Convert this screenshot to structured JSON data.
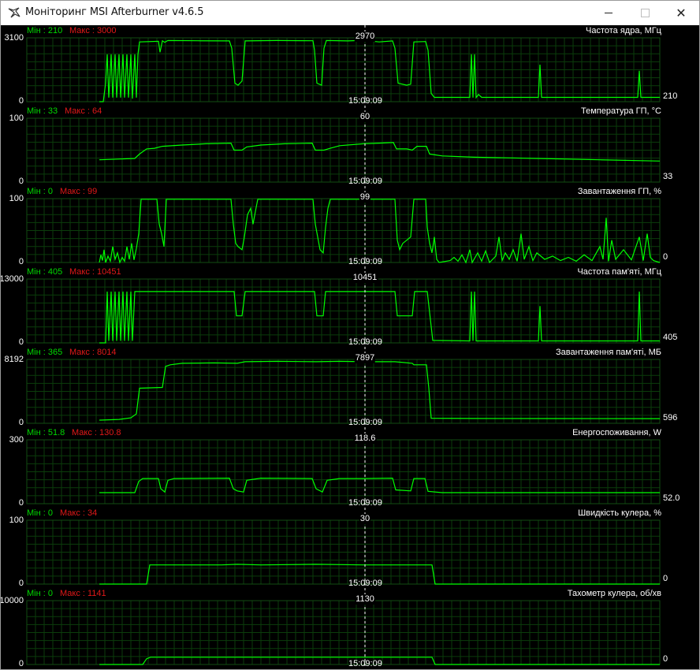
{
  "window": {
    "title": "Моніторинг MSI Afterburner v4.6.5",
    "controls": {
      "minimize": "minimize",
      "maximize": "maximize",
      "close": "close"
    }
  },
  "colors": {
    "background": "#000000",
    "grid": "#0b3d0b",
    "graph_line": "#00ff00",
    "cursor_line": "#ffffff",
    "min_text": "#00d800",
    "max_text": "#e01818"
  },
  "cursor_time": "15:09:09",
  "graphs": [
    {
      "name": "Частота ядра, МГц",
      "min_label": "Мін : 210",
      "max_label": "Макс : 3000",
      "y_top": "3100",
      "y_bottom": "0",
      "current": "210",
      "cursor_value": "2970",
      "ymax": 3100,
      "series": [
        [
          125,
          0
        ],
        [
          130,
          0
        ],
        [
          133,
          900
        ],
        [
          135,
          2300
        ],
        [
          137,
          200
        ],
        [
          140,
          2300
        ],
        [
          142,
          200
        ],
        [
          145,
          2300
        ],
        [
          147,
          200
        ],
        [
          150,
          2300
        ],
        [
          152,
          200
        ],
        [
          155,
          2300
        ],
        [
          157,
          200
        ],
        [
          160,
          2300
        ],
        [
          162,
          200
        ],
        [
          165,
          2300
        ],
        [
          167,
          150
        ],
        [
          170,
          2300
        ],
        [
          172,
          200
        ],
        [
          174,
          2300
        ],
        [
          176,
          2900
        ],
        [
          200,
          2930
        ],
        [
          202,
          2400
        ],
        [
          205,
          2960
        ],
        [
          208,
          2880
        ],
        [
          212,
          2970
        ],
        [
          250,
          2960
        ],
        [
          290,
          2950
        ],
        [
          293,
          2600
        ],
        [
          297,
          900
        ],
        [
          301,
          800
        ],
        [
          306,
          1000
        ],
        [
          310,
          2950
        ],
        [
          350,
          2970
        ],
        [
          396,
          2960
        ],
        [
          398,
          2500
        ],
        [
          401,
          900
        ],
        [
          407,
          800
        ],
        [
          410,
          2600
        ],
        [
          413,
          2970
        ],
        [
          440,
          2950
        ],
        [
          460,
          2980
        ],
        [
          480,
          2900
        ],
        [
          497,
          2950
        ],
        [
          500,
          2600
        ],
        [
          504,
          900
        ],
        [
          515,
          800
        ],
        [
          520,
          850
        ],
        [
          524,
          2900
        ],
        [
          539,
          2920
        ],
        [
          542,
          2500
        ],
        [
          546,
          400
        ],
        [
          550,
          210
        ],
        [
          595,
          210
        ],
        [
          597,
          2300
        ],
        [
          599,
          200
        ],
        [
          601,
          2300
        ],
        [
          603,
          200
        ],
        [
          606,
          350
        ],
        [
          610,
          210
        ],
        [
          682,
          210
        ],
        [
          684,
          1800
        ],
        [
          686,
          210
        ],
        [
          808,
          210
        ],
        [
          810,
          1500
        ],
        [
          812,
          210
        ],
        [
          836,
          210
        ]
      ]
    },
    {
      "name": "Температура ГП, °C",
      "min_label": "Мін : 33",
      "max_label": "Макс : 64",
      "y_top": "100",
      "y_bottom": "0",
      "current": "33",
      "cursor_value": "60",
      "ymax": 100,
      "series": [
        [
          125,
          35
        ],
        [
          150,
          36
        ],
        [
          170,
          37
        ],
        [
          176,
          44
        ],
        [
          185,
          52
        ],
        [
          195,
          53
        ],
        [
          205,
          56
        ],
        [
          230,
          58
        ],
        [
          260,
          60
        ],
        [
          292,
          61
        ],
        [
          296,
          50
        ],
        [
          306,
          50
        ],
        [
          312,
          55
        ],
        [
          330,
          58
        ],
        [
          360,
          60
        ],
        [
          395,
          61
        ],
        [
          399,
          50
        ],
        [
          410,
          50
        ],
        [
          418,
          53
        ],
        [
          430,
          57
        ],
        [
          460,
          60
        ],
        [
          480,
          61
        ],
        [
          498,
          62
        ],
        [
          502,
          52
        ],
        [
          515,
          52
        ],
        [
          522,
          50
        ],
        [
          528,
          56
        ],
        [
          540,
          56
        ],
        [
          544,
          44
        ],
        [
          560,
          41
        ],
        [
          600,
          39
        ],
        [
          680,
          37
        ],
        [
          760,
          35
        ],
        [
          836,
          33
        ]
      ]
    },
    {
      "name": "Завантаження ГП, %",
      "min_label": "Мін : 0",
      "max_label": "Макс : 99",
      "y_top": "100",
      "y_bottom": "0",
      "current": "0",
      "cursor_value": "99",
      "ymax": 100,
      "series": [
        [
          125,
          0
        ],
        [
          127,
          12
        ],
        [
          129,
          3
        ],
        [
          131,
          20
        ],
        [
          133,
          0
        ],
        [
          136,
          10
        ],
        [
          139,
          2
        ],
        [
          142,
          25
        ],
        [
          145,
          5
        ],
        [
          148,
          15
        ],
        [
          151,
          0
        ],
        [
          154,
          8
        ],
        [
          157,
          2
        ],
        [
          160,
          25
        ],
        [
          163,
          5
        ],
        [
          166,
          30
        ],
        [
          169,
          4
        ],
        [
          172,
          22
        ],
        [
          175,
          45
        ],
        [
          178,
          99
        ],
        [
          198,
          99
        ],
        [
          201,
          60
        ],
        [
          204,
          45
        ],
        [
          207,
          25
        ],
        [
          210,
          99
        ],
        [
          292,
          99
        ],
        [
          295,
          60
        ],
        [
          298,
          30
        ],
        [
          301,
          25
        ],
        [
          306,
          20
        ],
        [
          309,
          40
        ],
        [
          313,
          75
        ],
        [
          317,
          85
        ],
        [
          320,
          60
        ],
        [
          323,
          80
        ],
        [
          326,
          99
        ],
        [
          396,
          99
        ],
        [
          399,
          60
        ],
        [
          402,
          40
        ],
        [
          405,
          20
        ],
        [
          409,
          15
        ],
        [
          412,
          55
        ],
        [
          415,
          85
        ],
        [
          418,
          99
        ],
        [
          500,
          99
        ],
        [
          503,
          35
        ],
        [
          506,
          20
        ],
        [
          510,
          30
        ],
        [
          515,
          35
        ],
        [
          520,
          40
        ],
        [
          524,
          99
        ],
        [
          539,
          99
        ],
        [
          541,
          55
        ],
        [
          544,
          30
        ],
        [
          547,
          15
        ],
        [
          550,
          40
        ],
        [
          553,
          5
        ],
        [
          556,
          0
        ],
        [
          570,
          3
        ],
        [
          575,
          8
        ],
        [
          580,
          2
        ],
        [
          585,
          12
        ],
        [
          590,
          0
        ],
        [
          595,
          20
        ],
        [
          598,
          0
        ],
        [
          605,
          15
        ],
        [
          610,
          2
        ],
        [
          615,
          18
        ],
        [
          620,
          0
        ],
        [
          628,
          10
        ],
        [
          632,
          40
        ],
        [
          636,
          3
        ],
        [
          640,
          15
        ],
        [
          645,
          5
        ],
        [
          650,
          20
        ],
        [
          655,
          2
        ],
        [
          660,
          45
        ],
        [
          664,
          5
        ],
        [
          670,
          25
        ],
        [
          675,
          3
        ],
        [
          680,
          15
        ],
        [
          690,
          5
        ],
        [
          700,
          10
        ],
        [
          710,
          3
        ],
        [
          720,
          8
        ],
        [
          730,
          2
        ],
        [
          740,
          12
        ],
        [
          750,
          3
        ],
        [
          760,
          25
        ],
        [
          764,
          5
        ],
        [
          768,
          70
        ],
        [
          771,
          2
        ],
        [
          775,
          35
        ],
        [
          780,
          5
        ],
        [
          790,
          20
        ],
        [
          800,
          4
        ],
        [
          810,
          40
        ],
        [
          815,
          3
        ],
        [
          820,
          45
        ],
        [
          824,
          8
        ],
        [
          828,
          3
        ],
        [
          836,
          0
        ]
      ]
    },
    {
      "name": "Частота пам'яті, МГц",
      "min_label": "Мін : 405",
      "max_label": "Макс : 10451",
      "y_top": "13000",
      "y_bottom": "0",
      "current": "405",
      "cursor_value": "10451",
      "ymax": 13000,
      "series": [
        [
          125,
          0
        ],
        [
          133,
          0
        ],
        [
          135,
          10451
        ],
        [
          137,
          400
        ],
        [
          140,
          10451
        ],
        [
          142,
          400
        ],
        [
          145,
          10451
        ],
        [
          147,
          400
        ],
        [
          150,
          10451
        ],
        [
          152,
          400
        ],
        [
          155,
          10451
        ],
        [
          157,
          400
        ],
        [
          160,
          10451
        ],
        [
          162,
          400
        ],
        [
          165,
          10451
        ],
        [
          167,
          400
        ],
        [
          170,
          10451
        ],
        [
          173,
          10451
        ],
        [
          174,
          10451
        ],
        [
          296,
          10451
        ],
        [
          299,
          5500
        ],
        [
          306,
          5500
        ],
        [
          310,
          10451
        ],
        [
          398,
          10451
        ],
        [
          401,
          5500
        ],
        [
          409,
          5500
        ],
        [
          412,
          10451
        ],
        [
          500,
          10451
        ],
        [
          503,
          5500
        ],
        [
          522,
          5500
        ],
        [
          525,
          10451
        ],
        [
          541,
          10451
        ],
        [
          548,
          500
        ],
        [
          595,
          405
        ],
        [
          597,
          10451
        ],
        [
          599,
          405
        ],
        [
          601,
          10451
        ],
        [
          603,
          405
        ],
        [
          682,
          405
        ],
        [
          684,
          7500
        ],
        [
          686,
          405
        ],
        [
          808,
          405
        ],
        [
          810,
          10451
        ],
        [
          812,
          405
        ],
        [
          836,
          405
        ]
      ]
    },
    {
      "name": "Завантаження пам'яті, МБ",
      "min_label": "Мін : 365",
      "max_label": "Макс : 8014",
      "y_top": "8192",
      "y_bottom": "0",
      "current": "596",
      "cursor_value": "7897",
      "ymax": 8192,
      "series": [
        [
          125,
          400
        ],
        [
          150,
          500
        ],
        [
          165,
          700
        ],
        [
          172,
          1200
        ],
        [
          176,
          4500
        ],
        [
          205,
          4600
        ],
        [
          209,
          7300
        ],
        [
          215,
          7500
        ],
        [
          230,
          7700
        ],
        [
          270,
          7750
        ],
        [
          300,
          7700
        ],
        [
          310,
          7900
        ],
        [
          350,
          7950
        ],
        [
          400,
          7900
        ],
        [
          430,
          7950
        ],
        [
          460,
          7897
        ],
        [
          500,
          7900
        ],
        [
          522,
          7700
        ],
        [
          524,
          7500
        ],
        [
          540,
          7500
        ],
        [
          543,
          4500
        ],
        [
          546,
          650
        ],
        [
          600,
          620
        ],
        [
          700,
          610
        ],
        [
          836,
          596
        ]
      ]
    },
    {
      "name": "Енергоспоживання, W",
      "min_label": "Мін : 51.8",
      "max_label": "Макс : 130.8",
      "y_top": "300",
      "y_bottom": "0",
      "current": "52.0",
      "cursor_value": "118.6",
      "ymax": 300,
      "series": [
        [
          125,
          52
        ],
        [
          170,
          52
        ],
        [
          175,
          105
        ],
        [
          180,
          118
        ],
        [
          200,
          118
        ],
        [
          203,
          70
        ],
        [
          208,
          55
        ],
        [
          212,
          110
        ],
        [
          220,
          118
        ],
        [
          290,
          120
        ],
        [
          295,
          70
        ],
        [
          300,
          60
        ],
        [
          308,
          55
        ],
        [
          312,
          110
        ],
        [
          330,
          120
        ],
        [
          395,
          118
        ],
        [
          400,
          70
        ],
        [
          408,
          55
        ],
        [
          414,
          110
        ],
        [
          430,
          118
        ],
        [
          460,
          118
        ],
        [
          497,
          120
        ],
        [
          501,
          65
        ],
        [
          520,
          60
        ],
        [
          524,
          118
        ],
        [
          538,
          118
        ],
        [
          542,
          58
        ],
        [
          560,
          52
        ],
        [
          700,
          52
        ],
        [
          836,
          52
        ]
      ]
    },
    {
      "name": "Швидкість кулера, %",
      "min_label": "Мін : 0",
      "max_label": "Макс : 34",
      "y_top": "100",
      "y_bottom": "0",
      "current": "0",
      "cursor_value": "30",
      "ymax": 100,
      "series": [
        [
          125,
          0
        ],
        [
          185,
          0
        ],
        [
          189,
          30
        ],
        [
          280,
          30
        ],
        [
          300,
          31
        ],
        [
          330,
          30
        ],
        [
          400,
          31
        ],
        [
          460,
          30
        ],
        [
          547,
          30
        ],
        [
          551,
          0
        ],
        [
          836,
          0
        ]
      ]
    },
    {
      "name": "Тахометр кулера, об/хв",
      "min_label": "Мін : 0",
      "max_label": "Макс : 1141",
      "y_top": "10000",
      "y_bottom": "0",
      "current": "0",
      "cursor_value": "1130",
      "ymax": 10000,
      "series": [
        [
          125,
          0
        ],
        [
          180,
          0
        ],
        [
          185,
          900
        ],
        [
          190,
          1130
        ],
        [
          300,
          1141
        ],
        [
          400,
          1130
        ],
        [
          460,
          1130
        ],
        [
          547,
          1130
        ],
        [
          551,
          0
        ],
        [
          836,
          0
        ]
      ]
    }
  ]
}
